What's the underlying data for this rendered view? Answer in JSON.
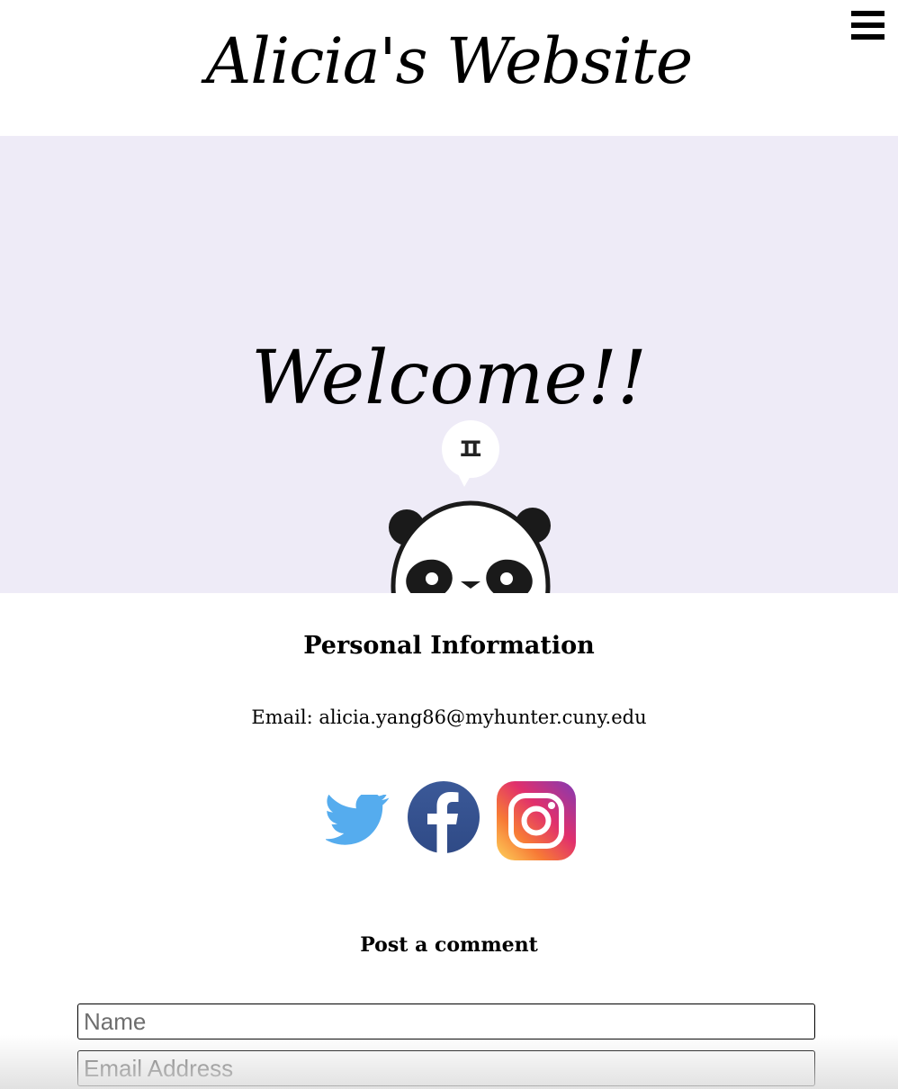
{
  "header": {
    "site_title": "Alicia's Website",
    "menu_icon": "hamburger-menu-icon"
  },
  "hero": {
    "welcome_text": "Welcome!!",
    "speech_bubble_text": "ㅍ",
    "background_color": "#eeebf7"
  },
  "personal_info": {
    "heading": "Personal Information",
    "email_line": "Email: alicia.yang86@myhunter.cuny.edu",
    "social_icons": [
      "twitter-icon",
      "facebook-icon",
      "instagram-icon"
    ]
  },
  "comment_form": {
    "heading": "Post a comment",
    "name_placeholder": "Name",
    "email_placeholder": "Email Address"
  }
}
